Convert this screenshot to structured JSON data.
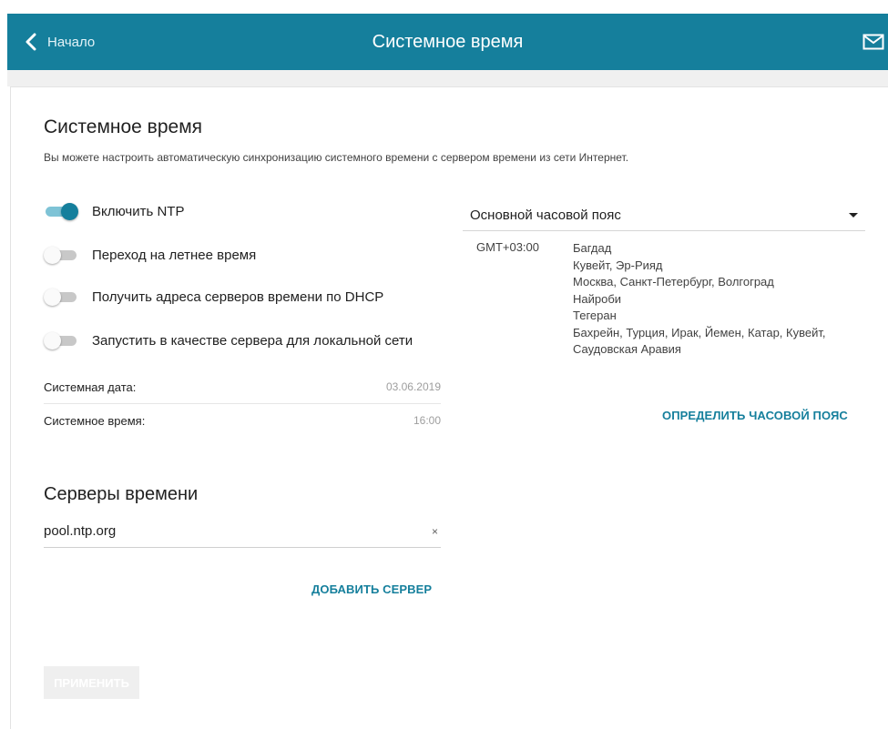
{
  "header": {
    "back_label": "Начало",
    "title": "Системное время",
    "back_icon": "chevron-left-icon",
    "mail_icon": "mail-icon",
    "bar_color": "#157f9c"
  },
  "section": {
    "title": "Системное время",
    "description": "Вы можете настроить автоматическую синхронизацию системного времени с сервером времени из сети Интернет."
  },
  "toggles": [
    {
      "label": "Включить NTP",
      "on": true
    },
    {
      "label": "Переход на летнее время",
      "on": false
    },
    {
      "label": "Получить адреса серверов времени по DHCP",
      "on": false
    },
    {
      "label": "Запустить в качестве сервера для локальной сети",
      "on": false
    }
  ],
  "system": {
    "date_label": "Системная дата:",
    "date_value": "03.06.2019",
    "time_label": "Системное время:",
    "time_value": "16:00"
  },
  "servers": {
    "title": "Серверы времени",
    "value": "pool.ntp.org",
    "clear_glyph": "×",
    "add_label": "ДОБАВИТЬ СЕРВЕР"
  },
  "apply_label": "ПРИМЕНИТЬ",
  "timezone": {
    "select_label": "Основной часовой пояс",
    "offset": "GMT+03:00",
    "cities": [
      "Багдад",
      "Кувейт, Эр-Рияд",
      "Москва, Санкт-Петербург, Волгоград",
      "Найроби",
      "Тегеран",
      "Бахрейн, Турция, Ирак, Йемен, Катар, Кувейт,",
      "Саудовская Аравия"
    ],
    "detect_label": "ОПРЕДЕЛИТЬ ЧАСОВОЙ ПОЯС"
  }
}
